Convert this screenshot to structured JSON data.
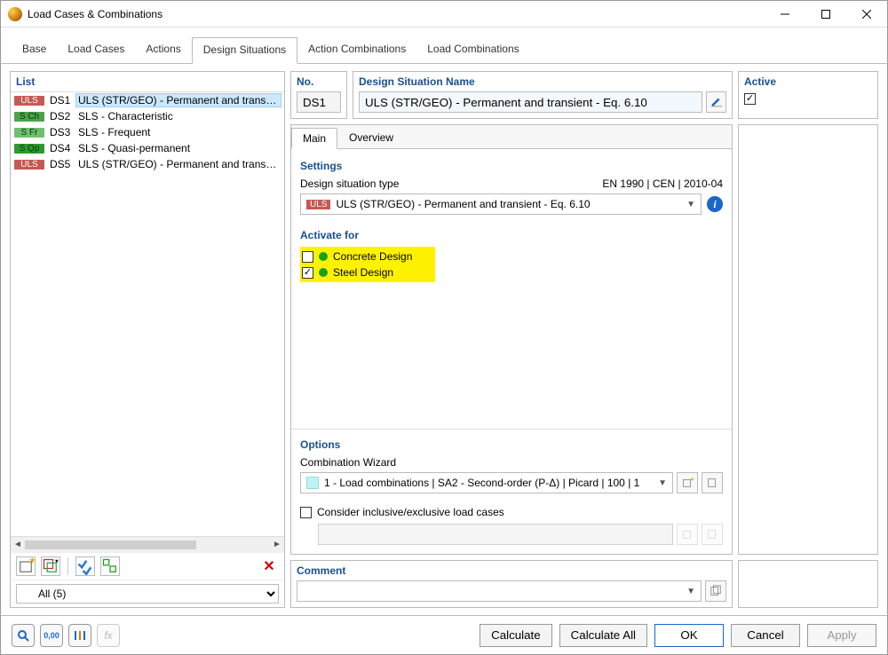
{
  "window": {
    "title": "Load Cases & Combinations"
  },
  "tabs": {
    "base": "Base",
    "loadcases": "Load Cases",
    "actions": "Actions",
    "design": "Design Situations",
    "action_comb": "Action Combinations",
    "load_comb": "Load Combinations"
  },
  "left": {
    "heading": "List",
    "filter": "All (5)",
    "items": [
      {
        "tag": "ULS",
        "tagcls": "uls",
        "id": "DS1",
        "desc": "ULS (STR/GEO) - Permanent and transient - E",
        "selected": true
      },
      {
        "tag": "S Ch",
        "tagcls": "sch",
        "id": "DS2",
        "desc": "SLS - Characteristic",
        "selected": false
      },
      {
        "tag": "S Fr",
        "tagcls": "sfr",
        "id": "DS3",
        "desc": "SLS - Frequent",
        "selected": false
      },
      {
        "tag": "S Qp",
        "tagcls": "sqp",
        "id": "DS4",
        "desc": "SLS - Quasi-permanent",
        "selected": false
      },
      {
        "tag": "ULS",
        "tagcls": "uls",
        "id": "DS5",
        "desc": "ULS (STR/GEO) - Permanent and transient - E",
        "selected": false
      }
    ]
  },
  "header": {
    "no_label": "No.",
    "no_value": "DS1",
    "name_label": "Design Situation Name",
    "name_value": "ULS (STR/GEO) - Permanent and transient - Eq. 6.10",
    "active_label": "Active",
    "active_checked": true
  },
  "innerTabs": {
    "main": "Main",
    "overview": "Overview"
  },
  "settings": {
    "heading": "Settings",
    "type_label": "Design situation type",
    "standard": "EN 1990 | CEN | 2010-04",
    "type_tag": "ULS",
    "type_value": "ULS (STR/GEO) - Permanent and transient - Eq. 6.10"
  },
  "activate": {
    "heading": "Activate for",
    "concrete": "Concrete Design",
    "concrete_checked": false,
    "steel": "Steel Design",
    "steel_checked": true
  },
  "options": {
    "heading": "Options",
    "wizard_label": "Combination Wizard",
    "wizard_value": "1 - Load combinations | SA2 - Second-order (P-Δ) | Picard | 100 | 1",
    "consider": "Consider inclusive/exclusive load cases",
    "consider_checked": false
  },
  "comment": {
    "heading": "Comment",
    "value": ""
  },
  "buttons": {
    "calculate": "Calculate",
    "calculate_all": "Calculate All",
    "ok": "OK",
    "cancel": "Cancel",
    "apply": "Apply"
  }
}
